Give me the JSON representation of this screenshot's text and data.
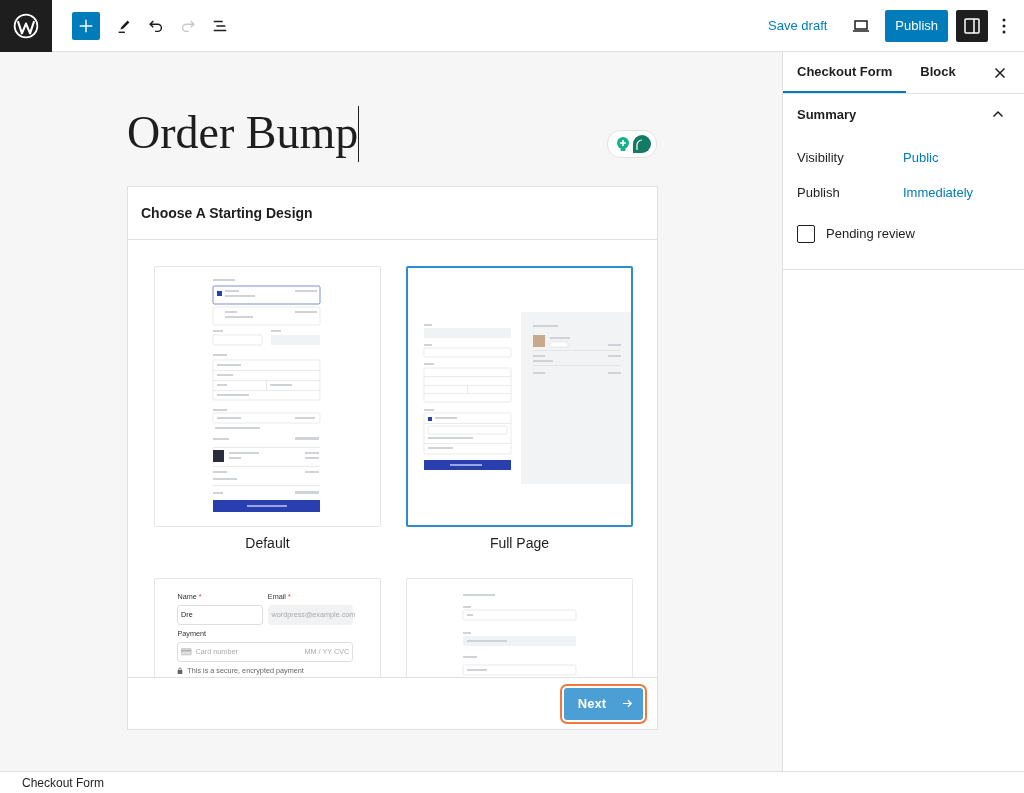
{
  "topbar": {
    "tools": [
      {
        "kind": "add",
        "disabled": false
      },
      {
        "kind": "edit",
        "disabled": false
      },
      {
        "kind": "undo",
        "disabled": false
      },
      {
        "kind": "redo",
        "disabled": true
      },
      {
        "kind": "outline",
        "disabled": false
      }
    ],
    "save_draft": "Save draft",
    "publish": "Publish",
    "settings_pressed": true
  },
  "editor": {
    "title": "Order Bump",
    "block": {
      "heading": "Choose A Starting Design",
      "designs": [
        {
          "label": "Default",
          "selected": false,
          "kind": "plan-form"
        },
        {
          "label": "Full Page",
          "selected": true,
          "kind": "split-form"
        },
        {
          "selected": false,
          "kind": "single",
          "blocks": [
            {
              "kind": "pair",
              "items": [
                {
                  "kind": "stack",
                  "items": [
                    {
                      "kind": "label",
                      "text": "Name",
                      "mark": "*"
                    },
                    {
                      "kind": "field",
                      "value": "Dre",
                      "readonly": false
                    }
                  ]
                },
                {
                  "kind": "stack",
                  "items": [
                    {
                      "kind": "label",
                      "text": "Email",
                      "mark": "*"
                    },
                    {
                      "kind": "field",
                      "placeholder": "wordpress@example.com",
                      "readonly": true
                    }
                  ]
                }
              ]
            },
            {
              "kind": "label",
              "text": "Payment"
            },
            {
              "kind": "card",
              "placeholder": "Card number",
              "suffix": "MM / YY  CVC"
            },
            {
              "kind": "note",
              "text": "This is a secure, encrypted payment"
            }
          ]
        },
        {
          "selected": false,
          "kind": "contact-form"
        }
      ],
      "next": {
        "label": "Next",
        "focused": true
      }
    }
  },
  "sidebar": {
    "tabs": [
      {
        "label": "Checkout Form",
        "selected": true
      },
      {
        "label": "Block",
        "selected": false
      }
    ],
    "panel": {
      "title": "Summary",
      "expanded": true,
      "rows": [
        {
          "label": "Visibility",
          "value": "Public"
        },
        {
          "label": "Publish",
          "value": "Immediately"
        }
      ],
      "pending": {
        "label": "Pending review",
        "checked": false
      }
    }
  },
  "status_bar": {
    "breadcrumb": "Checkout Form"
  }
}
